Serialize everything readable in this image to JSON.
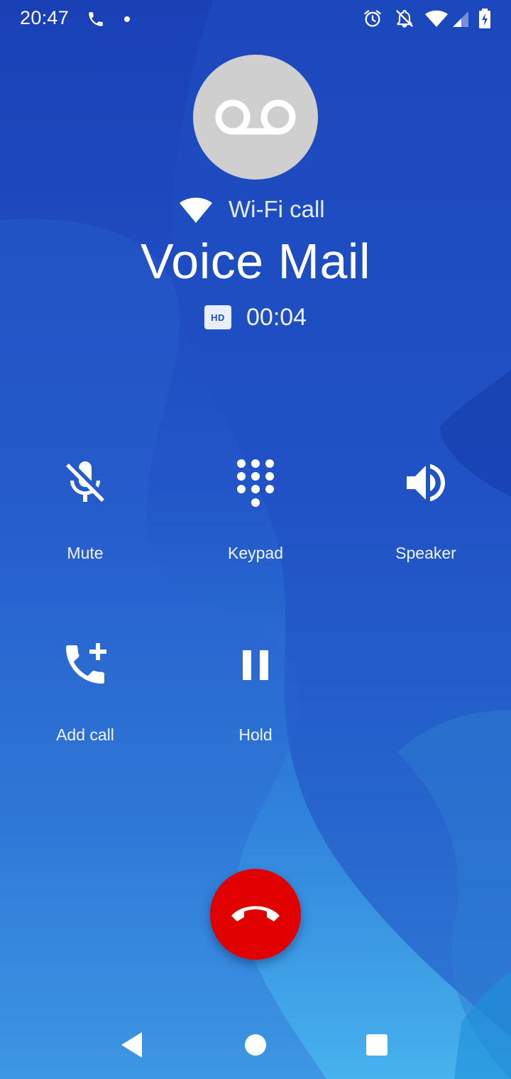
{
  "status_bar": {
    "time": "20:47",
    "icons": [
      "phone-icon",
      "dot-icon",
      "alarm-icon",
      "notifications-off-icon",
      "wifi-icon",
      "cell-signal-icon",
      "battery-charging-icon"
    ]
  },
  "call": {
    "avatar_icon": "voicemail-icon",
    "network_icon": "wifi-icon",
    "network_label": "Wi-Fi call",
    "caller_name": "Voice Mail",
    "hd_badge": "HD",
    "duration": "00:04"
  },
  "controls": {
    "mute": {
      "label": "Mute",
      "icon": "mic-off-icon"
    },
    "keypad": {
      "label": "Keypad",
      "icon": "dialpad-icon"
    },
    "speaker": {
      "label": "Speaker",
      "icon": "volume-icon"
    },
    "add_call": {
      "label": "Add call",
      "icon": "add-call-icon"
    },
    "hold": {
      "label": "Hold",
      "icon": "pause-icon"
    }
  },
  "end_call": {
    "icon": "call-end-icon",
    "color": "#e00000"
  },
  "nav_bar": {
    "buttons": [
      "back-icon",
      "home-icon",
      "recents-icon"
    ]
  },
  "colors": {
    "background_top": "#1a43b8",
    "background_bottom": "#48b0ec",
    "avatar": "#cfcfcf"
  }
}
